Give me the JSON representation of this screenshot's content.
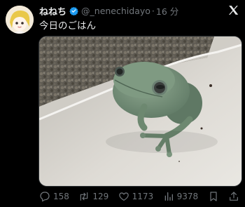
{
  "author": {
    "display_name": "ねねち",
    "handle": "@_nenechidayo",
    "separator": "·",
    "time_ago": "16 分"
  },
  "tweet": {
    "text": "今日のごはん"
  },
  "icons": {
    "verified": "verified-badge-icon",
    "platform": "x-logo-icon",
    "reply": "reply-icon",
    "retweet": "retweet-icon",
    "like": "like-icon",
    "views": "views-icon",
    "bookmark": "bookmark-icon",
    "share": "share-icon"
  },
  "colors": {
    "background": "#000000",
    "verified": "#1d9bf0",
    "muted": "#71767b",
    "text": "#e7e9ea"
  },
  "metrics": {
    "replies": "158",
    "retweets": "129",
    "likes": "1173",
    "views": "9378"
  }
}
